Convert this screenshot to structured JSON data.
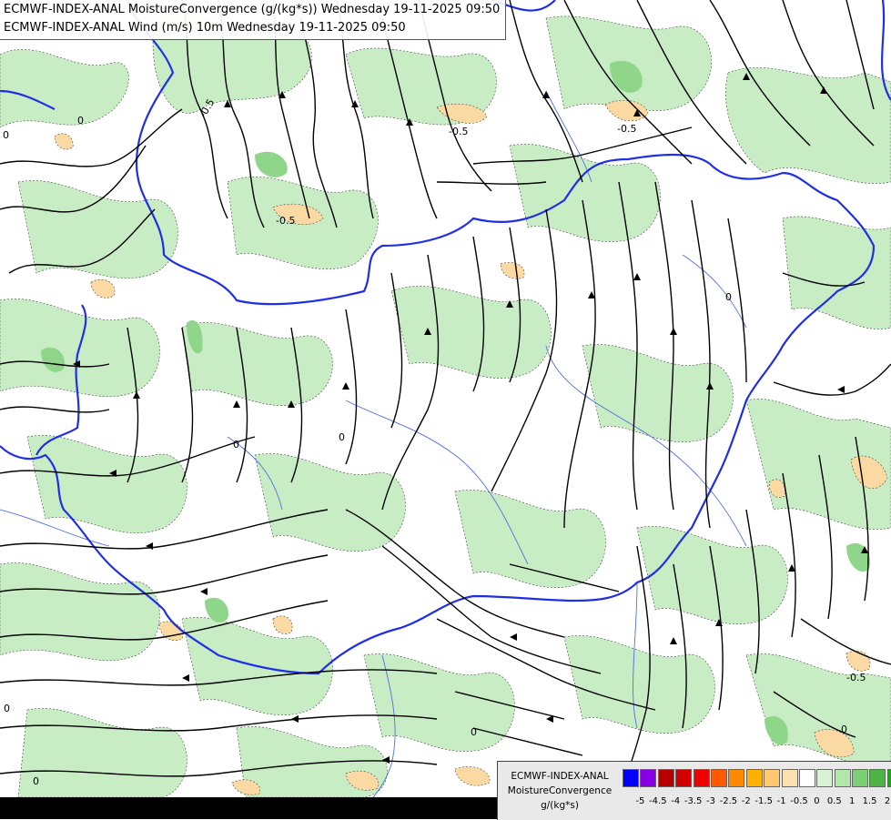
{
  "header": {
    "line1": "ECMWF-INDEX-ANAL MoistureConvergence (g/(kg*s)) Wednesday 19-11-2025 09:50",
    "line2": "ECMWF-INDEX-ANAL Wind (m/s) 10m Wednesday 19-11-2025 09:50"
  },
  "colors": {
    "green_light": "#c8ecc4",
    "green_mid": "#8fd68a",
    "green_dark": "#4fb04a",
    "orange_light": "#fbd9a2",
    "border": "#1f2fe6",
    "river": "#4f6fe0",
    "streamline": "#000000"
  },
  "contour_labels": [
    "-0.5",
    "-0.5",
    "-0.5",
    "-0.5",
    "-0.5",
    "0",
    "0",
    "0",
    "0",
    "0",
    "0",
    "0",
    "0",
    "0"
  ],
  "legend": {
    "title_line1": "ECMWF-INDEX-ANAL",
    "title_line2": "MoistureConvergence",
    "units": "g/(kg*s)",
    "swatch_colors": [
      "#0000ff",
      "#8a00e6",
      "#b40000",
      "#d20000",
      "#f00000",
      "#ff5a00",
      "#ff8a00",
      "#ffb000",
      "#ffc870",
      "#fde0b0",
      "#ffffff",
      "#d9f2d4",
      "#b3e6ab",
      "#7ccf72",
      "#4cb445",
      "#1ea51a"
    ],
    "tick_labels": [
      "-5",
      "-4.5",
      "-4",
      "-3.5",
      "-3",
      "-2.5",
      "-2",
      "-1.5",
      "-1",
      "-0.5",
      "0",
      "0.5",
      "1",
      "1.5",
      "2"
    ]
  }
}
